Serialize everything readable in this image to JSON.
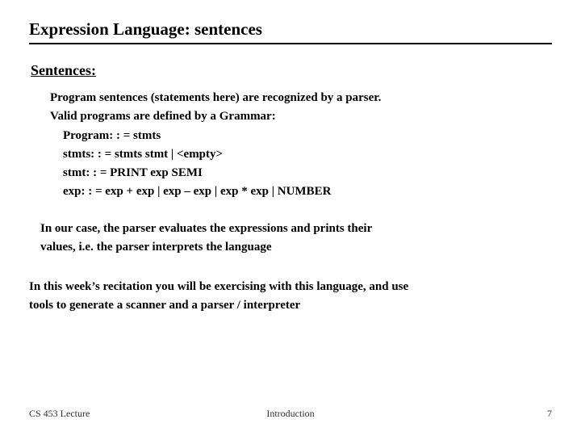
{
  "title": "Expression Language: sentences",
  "section": "Sentences:",
  "body": {
    "line1": "Program sentences (statements here) are recognized by a parser.",
    "line2": "Valid programs are defined by a Grammar:",
    "grammar": {
      "g1": "Program: : = stmts",
      "g2": "stmts: : =  stmts stmt     |    <empty>",
      "g3": "stmt: : =   PRINT exp SEMI",
      "g4": "exp: : =  exp + exp    |   exp – exp    | exp * exp  |  NUMBER"
    }
  },
  "interpret": {
    "l1": "In our case, the parser evaluates the expressions and prints their",
    "l2": "values, i.e. the parser interprets the language"
  },
  "recitation": {
    "l1": "In this week’s recitation you will be exercising with this language, and use",
    "l2": "tools to generate a scanner and a parser / interpreter"
  },
  "footer": {
    "left": "CS 453 Lecture",
    "center": "Introduction",
    "right": "7"
  }
}
